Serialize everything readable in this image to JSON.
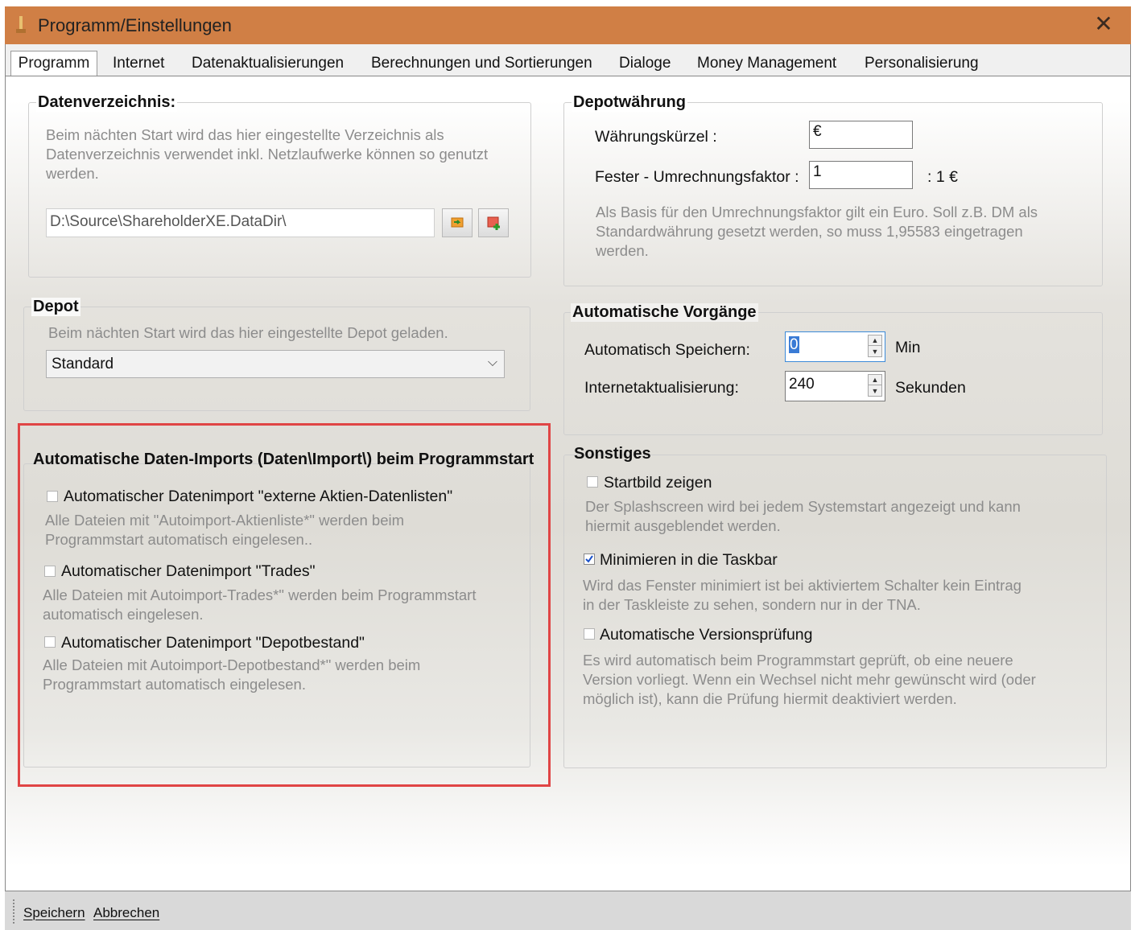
{
  "window": {
    "title": "Programm/Einstellungen"
  },
  "tabs": [
    "Programm",
    "Internet",
    "Datenaktualisierungen",
    "Berechnungen und Sortierungen",
    "Dialoge",
    "Money Management",
    "Personalisierung"
  ],
  "datenverzeichnis": {
    "title": "Datenverzeichnis:",
    "description": "Beim nächten Start wird das hier eingestellte Verzeichnis als Datenverzeichnis verwendet inkl. Netzlaufwerke können so genutzt werden.",
    "path": "D:\\Source\\ShareholderXE.DataDir\\"
  },
  "depot": {
    "title": "Depot",
    "description": "Beim nächten Start wird das hier eingestellte Depot geladen.",
    "selected": "Standard"
  },
  "imports": {
    "title": "Automatische Daten-Imports (Daten\\Import\\) beim Programmstart",
    "items": [
      {
        "label": "Automatischer Datenimport \"externe Aktien-Datenlisten\"",
        "desc": "Alle Dateien mit \"Autoimport-Aktienliste*\" werden beim Programmstart automatisch eingelesen.."
      },
      {
        "label": "Automatischer Datenimport \"Trades\"",
        "desc": "Alle Dateien mit Autoimport-Trades*\" werden beim Programmstart automatisch eingelesen."
      },
      {
        "label": "Automatischer Datenimport \"Depotbestand\"",
        "desc": "Alle Dateien mit Autoimport-Depotbestand*\" werden beim Programmstart automatisch eingelesen."
      }
    ]
  },
  "waehrung": {
    "title": "Depotwährung",
    "kuerzel_label": "Währungskürzel :",
    "kuerzel_value": "€",
    "faktor_label": "Fester - Umrechnungsfaktor :",
    "faktor_value": "1",
    "faktor_suffix": ": 1 €",
    "description": "Als Basis für den Umrechnungsfaktor gilt ein Euro. Soll z.B. DM als Standardwährung gesetzt werden, so muss 1,95583 eingetragen werden."
  },
  "automatisch": {
    "title": "Automatische Vorgänge",
    "speichern_label": "Automatisch Speichern:",
    "speichern_value": "0",
    "speichern_unit": "Min",
    "internet_label": "Internetaktualisierung:",
    "internet_value": "240",
    "internet_unit": "Sekunden"
  },
  "sonstiges": {
    "title": "Sonstiges",
    "items": [
      {
        "label": "Startbild zeigen",
        "checked": false,
        "desc": "Der Splashscreen wird bei jedem Systemstart angezeigt und kann hiermit ausgeblendet werden."
      },
      {
        "label": "Minimieren in die Taskbar",
        "checked": true,
        "desc": "Wird das Fenster minimiert ist bei aktiviertem Schalter kein Eintrag in der Taskleiste zu sehen, sondern nur in der TNA."
      },
      {
        "label": "Automatische Versionsprüfung",
        "checked": false,
        "desc": "Es wird automatisch beim Programmstart geprüft, ob eine neuere Version vorliegt. Wenn ein Wechsel nicht mehr gewünscht wird (oder möglich ist), kann die Prüfung hiermit deaktiviert werden."
      }
    ]
  },
  "buttons": {
    "save": "Speichern",
    "cancel": "Abbrechen"
  },
  "colors": {
    "titlebar": "#d07f45",
    "highlight": "#e04545"
  }
}
